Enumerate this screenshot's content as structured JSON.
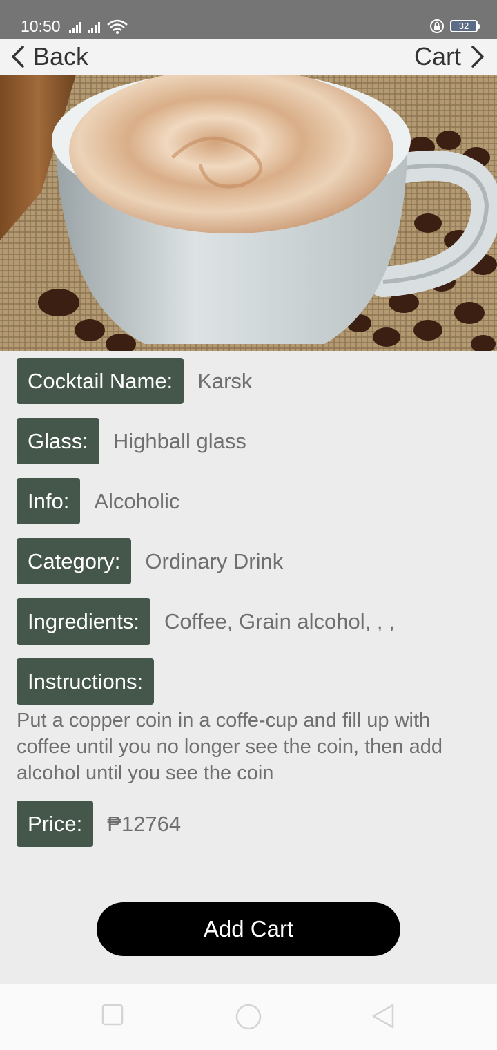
{
  "status_bar": {
    "time": "10:50",
    "battery_level": "32"
  },
  "nav": {
    "back_label": "Back",
    "cart_label": "Cart"
  },
  "hero_image": {
    "subject": "cup-of-coffee-with-beans"
  },
  "details": {
    "cocktail_name": {
      "label": "Cocktail Name:",
      "value": "Karsk"
    },
    "glass": {
      "label": "Glass:",
      "value": "Highball glass"
    },
    "info": {
      "label": "Info:",
      "value": "Alcoholic"
    },
    "category": {
      "label": "Category:",
      "value": "Ordinary Drink"
    },
    "ingredients": {
      "label": "Ingredients:",
      "value": "Coffee, Grain alcohol, , ,"
    },
    "instructions": {
      "label": "Instructions:",
      "value": "Put a copper coin in a coffe-cup and fill up with coffee until you no longer see the coin, then add alcohol until you see the coin"
    },
    "price": {
      "label": "Price:",
      "value": "₱12764"
    }
  },
  "actions": {
    "add_cart_label": "Add Cart"
  },
  "colors": {
    "chip_background": "#44574a",
    "button_background": "#000000",
    "status_bar": "#757575"
  }
}
